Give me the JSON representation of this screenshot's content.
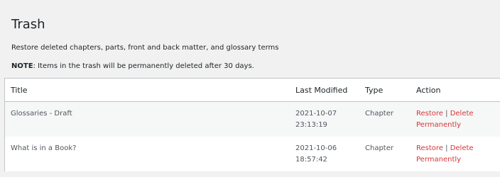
{
  "page": {
    "title": "Trash",
    "description": "Restore deleted chapters, parts, front and back matter, and glossary terms",
    "note_label": "NOTE",
    "note_text": ": Items in the trash will be permanently deleted after 30 days."
  },
  "table": {
    "headers": {
      "title": "Title",
      "last_modified": "Last Modified",
      "type": "Type",
      "action": "Action"
    },
    "rows": [
      {
        "title": "Glossaries - Draft",
        "date": "2021-10-07",
        "time": "23:13:19",
        "type": "Chapter",
        "restore": "Restore",
        "separator": "|",
        "delete": "Delete Permanently"
      },
      {
        "title": "What is in a Book?",
        "date": "2021-10-06",
        "time": "18:57:42",
        "type": "Chapter",
        "restore": "Restore",
        "separator": "|",
        "delete": "Delete Permanently"
      }
    ]
  },
  "colors": {
    "link": "#d63638",
    "background": "#f1f1f1",
    "row_alt": "#f6f7f7"
  }
}
